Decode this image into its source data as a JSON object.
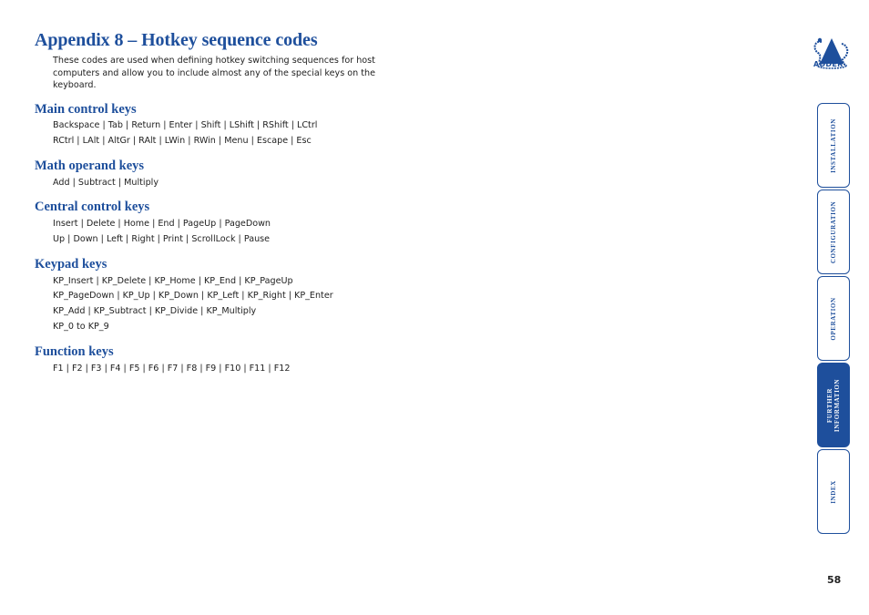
{
  "page": {
    "title": "Appendix 8 – Hotkey sequence codes",
    "intro": "These codes are used when defining hotkey switching sequences for host computers and allow you to include almost any of the special keys on the keyboard.",
    "page_number": "58"
  },
  "sections": [
    {
      "heading": "Main control keys",
      "lines": [
        "Backspace | Tab | Return | Enter | Shift | LShift | RShift | LCtrl",
        "RCtrl | LAlt | AltGr | RAlt | LWin | RWin | Menu | Escape | Esc"
      ]
    },
    {
      "heading": "Math operand keys",
      "lines": [
        "Add | Subtract | Multiply"
      ]
    },
    {
      "heading": "Central control keys",
      "lines": [
        "Insert | Delete | Home | End | PageUp | PageDown",
        "Up | Down | Left | Right | Print | ScrollLock | Pause"
      ]
    },
    {
      "heading": "Keypad keys",
      "lines": [
        "KP_Insert | KP_Delete | KP_Home | KP_End | KP_PageUp",
        "KP_PageDown | KP_Up | KP_Down | KP_Left | KP_Right | KP_Enter",
        "KP_Add | KP_Subtract | KP_Divide | KP_Multiply",
        "KP_0 to KP_9"
      ]
    },
    {
      "heading": "Function keys",
      "lines": [
        "F1 | F2 | F3 | F4 | F5 | F6 | F7 | F8 | F9 | F10 | F11 | F12"
      ]
    }
  ],
  "logo": {
    "text": "ADDER",
    "icon": "adder-snake-logo"
  },
  "nav_tabs": [
    {
      "label": "INSTALLATION",
      "active": false
    },
    {
      "label": "CONFIGURATION",
      "active": false
    },
    {
      "label": "OPERATION",
      "active": false
    },
    {
      "label": "FURTHER INFORMATION",
      "line1": "FURTHER",
      "line2": "INFORMATION",
      "active": true
    },
    {
      "label": "INDEX",
      "active": false
    }
  ],
  "colors": {
    "brand_blue": "#1e4f9c",
    "body_text": "#222222"
  }
}
